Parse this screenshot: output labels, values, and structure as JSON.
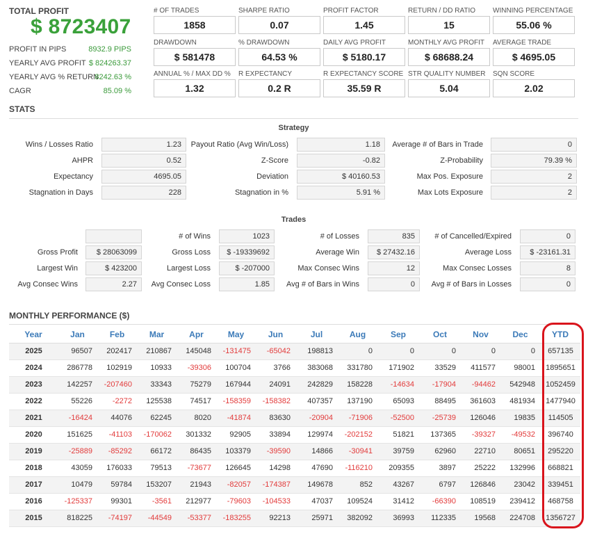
{
  "summary": {
    "total_profit_label": "TOTAL PROFIT",
    "total_profit_value": "$ 8723407",
    "rows": [
      {
        "label": "PROFIT IN PIPS",
        "value": "8932.9 PIPS"
      },
      {
        "label": "YEARLY AVG PROFIT",
        "value": "$ 824263.37"
      },
      {
        "label": "YEARLY AVG % RETURN",
        "value": "8242.63 %"
      },
      {
        "label": "CAGR",
        "value": "85.09 %"
      }
    ]
  },
  "metrics": [
    {
      "label": "# OF TRADES",
      "value": "1858"
    },
    {
      "label": "SHARPE RATIO",
      "value": "0.07"
    },
    {
      "label": "PROFIT FACTOR",
      "value": "1.45"
    },
    {
      "label": "RETURN / DD RATIO",
      "value": "15"
    },
    {
      "label": "WINNING PERCENTAGE",
      "value": "55.06 %"
    },
    {
      "label": "DRAWDOWN",
      "value": "$ 581478"
    },
    {
      "label": "% DRAWDOWN",
      "value": "64.53 %"
    },
    {
      "label": "DAILY AVG PROFIT",
      "value": "$ 5180.17"
    },
    {
      "label": "MONTHLY AVG PROFIT",
      "value": "$ 68688.24"
    },
    {
      "label": "AVERAGE TRADE",
      "value": "$ 4695.05"
    },
    {
      "label": "ANNUAL % / MAX DD %",
      "value": "1.32"
    },
    {
      "label": "R EXPECTANCY",
      "value": "0.2 R"
    },
    {
      "label": "R EXPECTANCY SCORE",
      "value": "35.59 R"
    },
    {
      "label": "STR QUALITY NUMBER",
      "value": "5.04"
    },
    {
      "label": "SQN SCORE",
      "value": "2.02"
    }
  ],
  "stats_title": "STATS",
  "strategy": {
    "title": "Strategy",
    "items": [
      {
        "label": "Wins / Losses Ratio",
        "value": "1.23"
      },
      {
        "label": "Payout Ratio (Avg Win/Loss)",
        "value": "1.18"
      },
      {
        "label": "Average # of Bars in Trade",
        "value": "0"
      },
      {
        "label": "AHPR",
        "value": "0.52"
      },
      {
        "label": "Z-Score",
        "value": "-0.82"
      },
      {
        "label": "Z-Probability",
        "value": "79.39 %"
      },
      {
        "label": "Expectancy",
        "value": "4695.05"
      },
      {
        "label": "Deviation",
        "value": "$ 40160.53"
      },
      {
        "label": "Max Pos. Exposure",
        "value": "2"
      },
      {
        "label": "Stagnation in Days",
        "value": "228"
      },
      {
        "label": "Stagnation in %",
        "value": "5.91 %"
      },
      {
        "label": "Max Lots Exposure",
        "value": "2"
      }
    ]
  },
  "trades": {
    "title": "Trades",
    "items": [
      {
        "label": "",
        "value": ""
      },
      {
        "label": "# of Wins",
        "value": "1023"
      },
      {
        "label": "# of Losses",
        "value": "835"
      },
      {
        "label": "# of Cancelled/Expired",
        "value": "0"
      },
      {
        "label": "Gross Profit",
        "value": "$ 28063099"
      },
      {
        "label": "Gross Loss",
        "value": "$ -19339692"
      },
      {
        "label": "Average Win",
        "value": "$ 27432.16"
      },
      {
        "label": "Average Loss",
        "value": "$ -23161.31"
      },
      {
        "label": "Largest Win",
        "value": "$ 423200"
      },
      {
        "label": "Largest Loss",
        "value": "$ -207000"
      },
      {
        "label": "Max Consec Wins",
        "value": "12"
      },
      {
        "label": "Max Consec Losses",
        "value": "8"
      },
      {
        "label": "Avg Consec Wins",
        "value": "2.27"
      },
      {
        "label": "Avg Consec Loss",
        "value": "1.85"
      },
      {
        "label": "Avg # of Bars in Wins",
        "value": "0"
      },
      {
        "label": "Avg # of Bars in Losses",
        "value": "0"
      }
    ]
  },
  "monthly": {
    "title": "MONTHLY PERFORMANCE ($)",
    "headers": [
      "Year",
      "Jan",
      "Feb",
      "Mar",
      "Apr",
      "May",
      "Jun",
      "Jul",
      "Aug",
      "Sep",
      "Oct",
      "Nov",
      "Dec",
      "YTD"
    ],
    "rows": [
      [
        "2025",
        "96507",
        "202417",
        "210867",
        "145048",
        "-131475",
        "-65042",
        "198813",
        "0",
        "0",
        "0",
        "0",
        "0",
        "657135"
      ],
      [
        "2024",
        "286778",
        "102919",
        "10933",
        "-39306",
        "100704",
        "3766",
        "383068",
        "331780",
        "171902",
        "33529",
        "411577",
        "98001",
        "1895651"
      ],
      [
        "2023",
        "142257",
        "-207460",
        "33343",
        "75279",
        "167944",
        "24091",
        "242829",
        "158228",
        "-14634",
        "-17904",
        "-94462",
        "542948",
        "1052459"
      ],
      [
        "2022",
        "55226",
        "-2272",
        "125538",
        "74517",
        "-158359",
        "-158382",
        "407357",
        "137190",
        "65093",
        "88495",
        "361603",
        "481934",
        "1477940"
      ],
      [
        "2021",
        "-16424",
        "44076",
        "62245",
        "8020",
        "-41874",
        "83630",
        "-20904",
        "-71906",
        "-52500",
        "-25739",
        "126046",
        "19835",
        "114505"
      ],
      [
        "2020",
        "151625",
        "-41103",
        "-170062",
        "301332",
        "92905",
        "33894",
        "129974",
        "-202152",
        "51821",
        "137365",
        "-39327",
        "-49532",
        "396740"
      ],
      [
        "2019",
        "-25889",
        "-85292",
        "66172",
        "86435",
        "103379",
        "-39590",
        "14866",
        "-30941",
        "39759",
        "62960",
        "22710",
        "80651",
        "295220"
      ],
      [
        "2018",
        "43059",
        "176033",
        "79513",
        "-73677",
        "126645",
        "14298",
        "47690",
        "-116210",
        "209355",
        "3897",
        "25222",
        "132996",
        "668821"
      ],
      [
        "2017",
        "10479",
        "59784",
        "153207",
        "21943",
        "-82057",
        "-174387",
        "149678",
        "852",
        "43267",
        "6797",
        "126846",
        "23042",
        "339451"
      ],
      [
        "2016",
        "-125337",
        "99301",
        "-3561",
        "212977",
        "-79603",
        "-104533",
        "47037",
        "109524",
        "31412",
        "-66390",
        "108519",
        "239412",
        "468758"
      ],
      [
        "2015",
        "818225",
        "-74197",
        "-44549",
        "-53377",
        "-183255",
        "92213",
        "25971",
        "382092",
        "36993",
        "112335",
        "19568",
        "224708",
        "1356727"
      ]
    ]
  },
  "colors": {
    "profit_green": "#3aa13a",
    "negative_red": "#e23b3b",
    "header_blue": "#3b7ab8",
    "highlight_red": "#d9141c"
  }
}
